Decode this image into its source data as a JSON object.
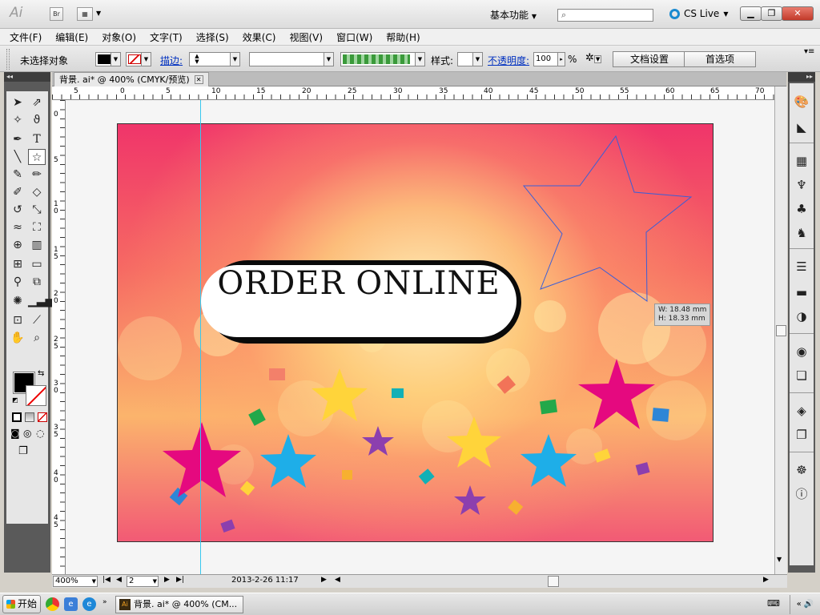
{
  "app": {
    "logo": "Ai",
    "bridge_label": "Br",
    "workspace": "基本功能",
    "cs_live": "CS Live"
  },
  "menu": [
    "文件(F)",
    "编辑(E)",
    "对象(O)",
    "文字(T)",
    "选择(S)",
    "效果(C)",
    "视图(V)",
    "窗口(W)",
    "帮助(H)"
  ],
  "control": {
    "selection": "未选择对象",
    "stroke_label": "描边:",
    "style_label": "样式:",
    "opacity_label": "不透明度:",
    "opacity_value": "100",
    "percent": "%",
    "doc_setup": "文档设置",
    "preferences": "首选项"
  },
  "document": {
    "tab": "背景. ai* @ 400% (CMYK/预览)"
  },
  "rulers": {
    "h": [
      "5",
      "0",
      "5",
      "10",
      "15",
      "20",
      "25",
      "30",
      "35",
      "40",
      "45",
      "50",
      "55",
      "60",
      "65",
      "70"
    ],
    "v": [
      "0",
      "5",
      "10",
      "15",
      "20",
      "25",
      "30",
      "35",
      "40",
      "45"
    ]
  },
  "canvas": {
    "button_text": "ORDER ONLINE",
    "dim_w": "W: 18.48 mm",
    "dim_h": "H: 18.33 mm"
  },
  "status": {
    "zoom": "400%",
    "artboard": "2",
    "info": "2013-2-26  11:17"
  },
  "taskbar": {
    "start": "开始",
    "task": "背景. ai* @ 400% (CM..."
  }
}
